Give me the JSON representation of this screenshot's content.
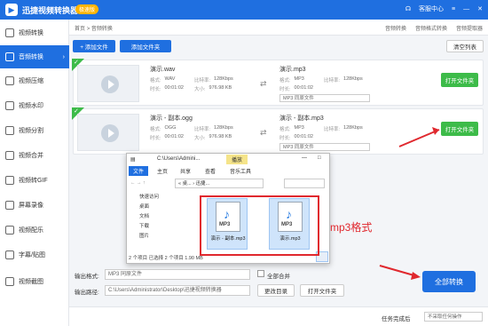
{
  "app": {
    "title": "迅捷视频转换器",
    "badge": "极速版",
    "service": "客服中心"
  },
  "sidebar": {
    "items": [
      {
        "label": "视频转换",
        "active": false
      },
      {
        "label": "音频转换",
        "active": true
      },
      {
        "label": "视频压缩",
        "active": false
      },
      {
        "label": "视频水印",
        "active": false
      },
      {
        "label": "视频分割",
        "active": false
      },
      {
        "label": "视频合并",
        "active": false
      },
      {
        "label": "视频转GIF",
        "active": false
      },
      {
        "label": "屏幕录像",
        "active": false
      },
      {
        "label": "视频配乐",
        "active": false
      },
      {
        "label": "字幕/贴图",
        "active": false
      },
      {
        "label": "视频截图",
        "active": false
      }
    ]
  },
  "breadcrumb": {
    "home": "首页",
    "sep": ">",
    "current": "音频转换",
    "right": [
      "音频转换",
      "音频格式转换",
      "音频提取器"
    ]
  },
  "toolbar": {
    "add_file": "+ 添加文件",
    "add_folder": "添加文件夹",
    "clear_list": "清空列表"
  },
  "files": [
    {
      "name": "演示.wav",
      "format_label": "格式:",
      "format": "WAV",
      "bitrate_label": "比特率:",
      "bitrate": "128Kbps",
      "duration_label": "时长:",
      "duration": "00:01:02",
      "size_label": "大小:",
      "size": "976.98 KB",
      "out_name": "演示.mp3",
      "out_format": "MP3",
      "out_bitrate": "128Kbps",
      "out_duration": "00:01:02",
      "out_preset": "MP3 同原文件",
      "open_button": "打开文件夹"
    },
    {
      "name": "演示 - 副本.ogg",
      "format_label": "格式:",
      "format": "OGG",
      "bitrate_label": "比特率:",
      "bitrate": "128Kbps",
      "duration_label": "时长:",
      "duration": "00:01:02",
      "size_label": "大小:",
      "size": "976.98 KB",
      "out_name": "演示 - 副本.mp3",
      "out_format": "MP3",
      "out_bitrate": "128Kbps",
      "out_duration": "00:01:02",
      "out_preset": "MP3 同原文件",
      "open_button": "打开文件夹"
    }
  ],
  "output": {
    "format_label": "输出格式:",
    "format_value": "MP3 同原文件",
    "merge_label": "全部合并",
    "path_label": "输出路径:",
    "path_value": "C:\\Users\\Administrator\\Desktop\\迅捷视频转换器",
    "change_dir": "更改目录",
    "open_folder": "打开文件夹",
    "convert_all": "全部转换"
  },
  "status": {
    "left": "任务完成后",
    "right": "不采取任何操作"
  },
  "explorer": {
    "title": "C:\\Users\\Admini...",
    "tool_tab": "播放",
    "tabs": [
      "文件",
      "主页",
      "共享",
      "查看",
      "音乐工具"
    ],
    "address": "« 桌... › 迅捷...",
    "nav": [
      "快速访问",
      "桌面",
      "文档",
      "下载",
      "图片"
    ],
    "items": [
      {
        "name": "演示 - 副本.mp3",
        "icon": "MP3"
      },
      {
        "name": "演示.mp3",
        "icon": "MP3"
      }
    ],
    "status": "2 个项目  已选择 2 个项目  1.90 MB"
  },
  "annotation": {
    "label": "mp3格式",
    "color": "#e0282e"
  },
  "colors": {
    "accent": "#1f6fe0",
    "green": "#3dbb49",
    "red": "#e0282e"
  }
}
